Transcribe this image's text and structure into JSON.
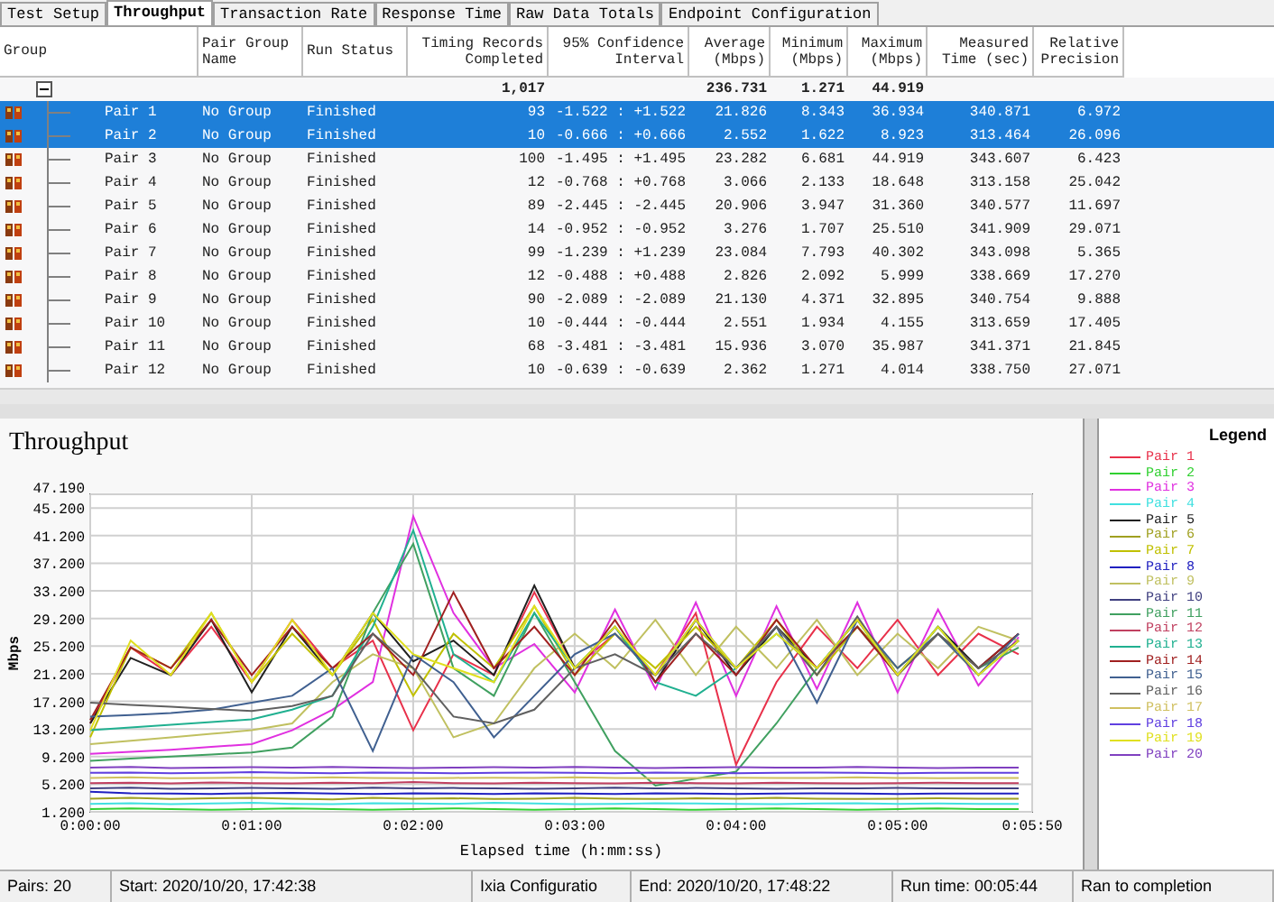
{
  "tabs": [
    {
      "label": "Test Setup",
      "selected": false
    },
    {
      "label": "Throughput",
      "selected": true
    },
    {
      "label": "Transaction Rate",
      "selected": false
    },
    {
      "label": "Response Time",
      "selected": false
    },
    {
      "label": "Raw Data Totals",
      "selected": false
    },
    {
      "label": "Endpoint Configuration",
      "selected": false
    }
  ],
  "table": {
    "columns": [
      "Group",
      "Pair Group Name",
      "Run Status",
      "Timing Records Completed",
      "95% Confidence Interval",
      "Average (Mbps)",
      "Minimum (Mbps)",
      "Maximum (Mbps)",
      "Measured Time (sec)",
      "Relative Precision"
    ],
    "summary": {
      "records": "1,017",
      "average": "236.731",
      "minimum": "1.271",
      "maximum": "44.919"
    },
    "rows": [
      {
        "name": "Pair 1",
        "group": "No Group",
        "status": "Finished",
        "records": "93",
        "ci": "-1.522 : +1.522",
        "average": "21.826",
        "minimum": "8.343",
        "maximum": "36.934",
        "time": "340.871",
        "precision": "6.972",
        "selected": true
      },
      {
        "name": "Pair 2",
        "group": "No Group",
        "status": "Finished",
        "records": "10",
        "ci": "-0.666 : +0.666",
        "average": "2.552",
        "minimum": "1.622",
        "maximum": "8.923",
        "time": "313.464",
        "precision": "26.096",
        "selected": true
      },
      {
        "name": "Pair 3",
        "group": "No Group",
        "status": "Finished",
        "records": "100",
        "ci": "-1.495 : +1.495",
        "average": "23.282",
        "minimum": "6.681",
        "maximum": "44.919",
        "time": "343.607",
        "precision": "6.423",
        "selected": false
      },
      {
        "name": "Pair 4",
        "group": "No Group",
        "status": "Finished",
        "records": "12",
        "ci": "-0.768 : +0.768",
        "average": "3.066",
        "minimum": "2.133",
        "maximum": "18.648",
        "time": "313.158",
        "precision": "25.042",
        "selected": false
      },
      {
        "name": "Pair 5",
        "group": "No Group",
        "status": "Finished",
        "records": "89",
        "ci": "-2.445 : -2.445",
        "average": "20.906",
        "minimum": "3.947",
        "maximum": "31.360",
        "time": "340.577",
        "precision": "11.697",
        "selected": false
      },
      {
        "name": "Pair 6",
        "group": "No Group",
        "status": "Finished",
        "records": "14",
        "ci": "-0.952 : -0.952",
        "average": "3.276",
        "minimum": "1.707",
        "maximum": "25.510",
        "time": "341.909",
        "precision": "29.071",
        "selected": false
      },
      {
        "name": "Pair 7",
        "group": "No Group",
        "status": "Finished",
        "records": "99",
        "ci": "-1.239 : +1.239",
        "average": "23.084",
        "minimum": "7.793",
        "maximum": "40.302",
        "time": "343.098",
        "precision": "5.365",
        "selected": false
      },
      {
        "name": "Pair 8",
        "group": "No Group",
        "status": "Finished",
        "records": "12",
        "ci": "-0.488 : +0.488",
        "average": "2.826",
        "minimum": "2.092",
        "maximum": "5.999",
        "time": "338.669",
        "precision": "17.270",
        "selected": false
      },
      {
        "name": "Pair 9",
        "group": "No Group",
        "status": "Finished",
        "records": "90",
        "ci": "-2.089 : -2.089",
        "average": "21.130",
        "minimum": "4.371",
        "maximum": "32.895",
        "time": "340.754",
        "precision": "9.888",
        "selected": false
      },
      {
        "name": "Pair 10",
        "group": "No Group",
        "status": "Finished",
        "records": "10",
        "ci": "-0.444 : -0.444",
        "average": "2.551",
        "minimum": "1.934",
        "maximum": "4.155",
        "time": "313.659",
        "precision": "17.405",
        "selected": false
      },
      {
        "name": "Pair 11",
        "group": "No Group",
        "status": "Finished",
        "records": "68",
        "ci": "-3.481 : -3.481",
        "average": "15.936",
        "minimum": "3.070",
        "maximum": "35.987",
        "time": "341.371",
        "precision": "21.845",
        "selected": false
      },
      {
        "name": "Pair 12",
        "group": "No Group",
        "status": "Finished",
        "records": "10",
        "ci": "-0.639 : -0.639",
        "average": "2.362",
        "minimum": "1.271",
        "maximum": "4.014",
        "time": "338.750",
        "precision": "27.071",
        "selected": false
      }
    ]
  },
  "chart": {
    "legend_title": "Legend",
    "chart_data": {
      "type": "line",
      "title": "Throughput",
      "xlabel": "Elapsed time (h:mm:ss)",
      "ylabel": "Mbps",
      "grid": true,
      "x": [
        0,
        15,
        30,
        45,
        60,
        75,
        90,
        105,
        120,
        135,
        150,
        165,
        180,
        195,
        210,
        225,
        240,
        255,
        270,
        285,
        300,
        315,
        330,
        345
      ],
      "xlim": [
        0,
        350
      ],
      "ylim": [
        1.2,
        47.19
      ],
      "xticks": [
        {
          "value": 0,
          "label": "0:00:00"
        },
        {
          "value": 60,
          "label": "0:01:00"
        },
        {
          "value": 120,
          "label": "0:02:00"
        },
        {
          "value": 180,
          "label": "0:03:00"
        },
        {
          "value": 240,
          "label": "0:04:00"
        },
        {
          "value": 300,
          "label": "0:05:00"
        },
        {
          "value": 350,
          "label": "0:05:50"
        }
      ],
      "yticks": [
        {
          "value": 1.2,
          "label": "1.200"
        },
        {
          "value": 5.2,
          "label": "5.200"
        },
        {
          "value": 9.2,
          "label": "9.200"
        },
        {
          "value": 13.2,
          "label": "13.200"
        },
        {
          "value": 17.2,
          "label": "17.200"
        },
        {
          "value": 21.2,
          "label": "21.200"
        },
        {
          "value": 25.2,
          "label": "25.200"
        },
        {
          "value": 29.2,
          "label": "29.200"
        },
        {
          "value": 33.2,
          "label": "33.200"
        },
        {
          "value": 37.2,
          "label": "37.200"
        },
        {
          "value": 41.2,
          "label": "41.200"
        },
        {
          "value": 45.2,
          "label": "45.200"
        },
        {
          "value": 47.19,
          "label": "47.190"
        }
      ],
      "series": [
        {
          "name": "Pair 1",
          "color": "#e8304a",
          "values": [
            14,
            25,
            21,
            28,
            20,
            29,
            22,
            26,
            13,
            24,
            21,
            33,
            22,
            27,
            21,
            30,
            8,
            20,
            28,
            22,
            29,
            21,
            27,
            24
          ]
        },
        {
          "name": "Pair 2",
          "color": "#30d030",
          "values": [
            1.6,
            1.7,
            1.6,
            1.5,
            1.6,
            1.7,
            1.6,
            1.5,
            1.6,
            1.7,
            1.6,
            1.5,
            1.6,
            1.7,
            1.6,
            1.5,
            1.6,
            1.7,
            1.6,
            1.5,
            1.6,
            1.7,
            1.6,
            1.6
          ]
        },
        {
          "name": "Pair 3",
          "color": "#e030e0",
          "values": [
            9.6,
            9.9,
            10.2,
            10.6,
            11,
            13,
            16,
            20,
            44,
            30,
            22,
            25.5,
            18.5,
            30.5,
            19,
            31.5,
            18,
            31,
            19,
            31.5,
            18.5,
            30.5,
            19.5,
            26.5
          ]
        },
        {
          "name": "Pair 4",
          "color": "#40e0e0",
          "values": [
            2.35,
            2.45,
            2.3,
            2.4,
            2.5,
            2.35,
            2.3,
            2.45,
            2.4,
            2.35,
            2.5,
            2.4,
            2.3,
            2.35,
            2.45,
            2.4,
            2.35,
            2.3,
            2.4,
            2.45,
            2.35,
            2.4,
            2.35,
            2.35
          ]
        },
        {
          "name": "Pair 5",
          "color": "#202020",
          "values": [
            14,
            23.5,
            21,
            29,
            18.5,
            28,
            21,
            30,
            23,
            26,
            21,
            34,
            22,
            28,
            20,
            29,
            21,
            28,
            22,
            29,
            21,
            28,
            22,
            27
          ]
        },
        {
          "name": "Pair 6",
          "color": "#a0a020",
          "values": [
            3.1,
            3.2,
            3.05,
            3.15,
            3.25,
            3.1,
            3.0,
            3.2,
            3.1,
            3.15,
            3.05,
            3.1,
            3.2,
            3.1,
            3.05,
            3.15,
            3.1,
            3.2,
            3.1,
            3.05,
            3.1,
            3.15,
            3.1,
            3.1
          ]
        },
        {
          "name": "Pair 7",
          "color": "#c0c000",
          "values": [
            12,
            25,
            22,
            30,
            20,
            27,
            21,
            29,
            18,
            27,
            22,
            31,
            21,
            27,
            22,
            28,
            22,
            29,
            21,
            28,
            22,
            27,
            21,
            26
          ]
        },
        {
          "name": "Pair 8",
          "color": "#2020c0",
          "values": [
            4.1,
            3.9,
            3.85,
            3.8,
            3.9,
            3.95,
            3.85,
            3.8,
            3.9,
            3.85,
            3.8,
            3.9,
            3.85,
            3.8,
            3.9,
            3.85,
            3.8,
            3.85,
            3.9,
            3.85,
            3.8,
            3.85,
            3.85,
            3.85
          ]
        },
        {
          "name": "Pair 9",
          "color": "#c0c060",
          "values": [
            11,
            11.5,
            12,
            12.5,
            13,
            14,
            20,
            24,
            22,
            12,
            14,
            22,
            27,
            22,
            29,
            21,
            28,
            22,
            29,
            21,
            27,
            22,
            28,
            26
          ]
        },
        {
          "name": "Pair 10",
          "color": "#404080",
          "values": [
            4.6,
            4.7,
            4.55,
            4.6,
            4.65,
            4.6,
            4.55,
            4.7,
            4.6,
            4.65,
            4.6,
            4.55,
            4.6,
            4.7,
            4.6,
            4.65,
            4.6,
            4.55,
            4.6,
            4.6,
            4.65,
            4.6,
            4.6,
            4.6
          ]
        },
        {
          "name": "Pair 11",
          "color": "#40a060",
          "values": [
            8.6,
            8.9,
            9.2,
            9.5,
            9.8,
            10.5,
            15,
            30,
            40,
            22,
            18,
            30,
            20,
            10,
            5,
            6,
            7,
            14,
            22,
            28,
            21,
            27,
            22,
            25
          ]
        },
        {
          "name": "Pair 12",
          "color": "#c04060",
          "values": [
            5.35,
            5.4,
            5.3,
            5.45,
            5.35,
            5.3,
            5.4,
            5.35,
            5.5,
            5.35,
            5.3,
            5.4,
            5.35,
            5.3,
            5.4,
            5.35,
            5.3,
            5.4,
            5.35,
            5.3,
            5.35,
            5.4,
            5.35,
            5.35
          ]
        },
        {
          "name": "Pair 13",
          "color": "#20b090",
          "values": [
            13,
            13.4,
            13.8,
            14.2,
            14.6,
            16,
            18,
            28,
            42,
            24,
            20,
            30,
            22,
            28,
            20,
            18,
            22,
            27,
            22,
            29,
            21,
            28,
            21,
            26
          ]
        },
        {
          "name": "Pair 14",
          "color": "#a02020",
          "values": [
            14.5,
            25,
            22,
            29,
            21,
            28,
            22,
            27,
            21,
            33,
            22,
            28,
            21,
            29,
            20,
            27,
            21,
            29,
            22,
            28,
            21,
            27,
            22,
            27
          ]
        },
        {
          "name": "Pair 15",
          "color": "#406090",
          "values": [
            15,
            15.2,
            15.5,
            16,
            17,
            18,
            22,
            10,
            24,
            20,
            12,
            18,
            24,
            27,
            21,
            29,
            22,
            28,
            17,
            29,
            22,
            27,
            21,
            27
          ]
        },
        {
          "name": "Pair 16",
          "color": "#606060",
          "values": [
            17,
            16.7,
            16.4,
            16.1,
            15.8,
            16.5,
            18,
            27,
            22,
            15,
            14,
            16,
            22,
            24,
            21,
            27,
            22,
            28,
            21,
            29.5,
            21,
            27,
            22,
            26
          ]
        },
        {
          "name": "Pair 17",
          "color": "#d0c060",
          "values": [
            6.1,
            6.2,
            6.05,
            6.1,
            6.15,
            6.1,
            6.2,
            6.1,
            6.05,
            6.1,
            6.15,
            6.1,
            6.2,
            6.1,
            6.05,
            6.1,
            6.15,
            6.1,
            6.1,
            6.2,
            6.1,
            6.05,
            6.1,
            6.1
          ]
        },
        {
          "name": "Pair 18",
          "color": "#6040e0",
          "values": [
            6.85,
            6.9,
            6.8,
            6.85,
            6.95,
            6.85,
            6.8,
            6.9,
            6.85,
            6.8,
            6.85,
            6.9,
            6.85,
            6.8,
            6.9,
            6.85,
            6.8,
            6.85,
            6.9,
            6.85,
            6.8,
            6.85,
            6.85,
            6.85
          ]
        },
        {
          "name": "Pair 19",
          "color": "#e0e020",
          "values": [
            13,
            26,
            21,
            30,
            20,
            29,
            21,
            30,
            24,
            22,
            20,
            31,
            22,
            28,
            21,
            29,
            22,
            27,
            22,
            29,
            21,
            28,
            21,
            26
          ]
        },
        {
          "name": "Pair 20",
          "color": "#8040c0",
          "values": [
            7.6,
            7.7,
            7.55,
            7.6,
            7.65,
            7.6,
            7.7,
            7.6,
            7.55,
            7.6,
            7.65,
            7.6,
            7.7,
            7.6,
            7.55,
            7.6,
            7.65,
            7.6,
            7.6,
            7.7,
            7.6,
            7.55,
            7.6,
            7.6
          ]
        }
      ]
    }
  },
  "status_bar": [
    "Pairs: 20",
    "Start: 2020/10/20, 17:42:38",
    "Ixia Configuratio",
    "End: 2020/10/20, 17:48:22",
    "Run time: 00:05:44",
    "Ran to completion"
  ]
}
